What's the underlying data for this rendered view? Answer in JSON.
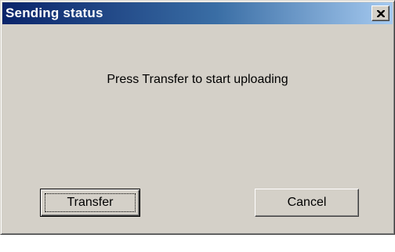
{
  "window": {
    "title": "Sending status",
    "close_icon": "close-icon"
  },
  "body": {
    "message": "Press Transfer to start uploading"
  },
  "buttons": {
    "transfer_label": "Transfer",
    "cancel_label": "Cancel"
  },
  "colors": {
    "title_bar_start": "#0a246a",
    "title_bar_end": "#a6caf0",
    "dialog_face": "#d4d0c8"
  }
}
